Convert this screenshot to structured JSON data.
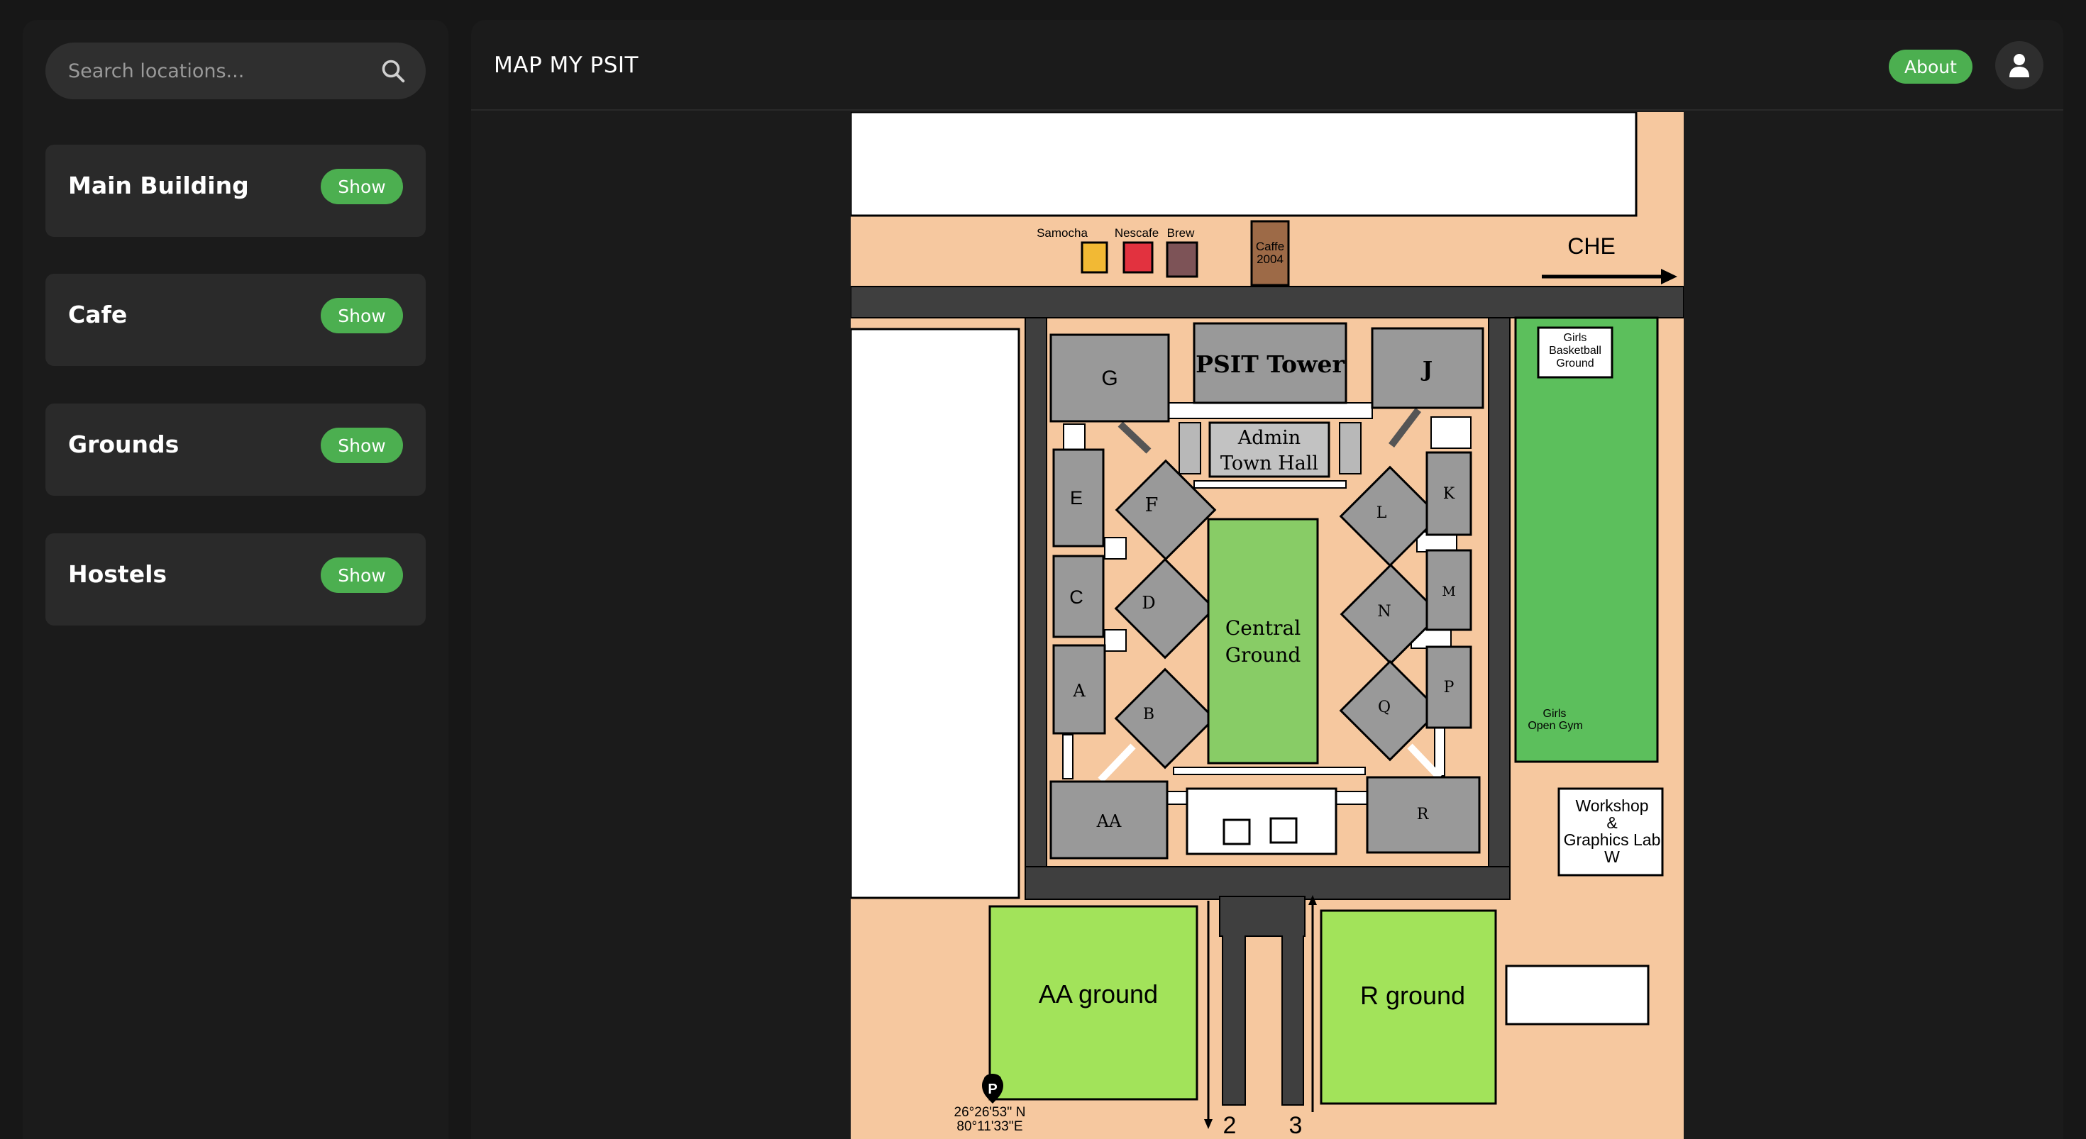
{
  "sidebar": {
    "search": {
      "placeholder": "Search locations..."
    },
    "categories": [
      {
        "label": "Main Building",
        "button": "Show"
      },
      {
        "label": "Cafe",
        "button": "Show"
      },
      {
        "label": "Grounds",
        "button": "Show"
      },
      {
        "label": "Hostels",
        "button": "Show"
      }
    ]
  },
  "header": {
    "title": "MAP MY PSIT",
    "about_label": "About"
  },
  "map": {
    "cafes": {
      "samocha": "Samocha",
      "nescafe": "Nescafe",
      "brew": "Brew",
      "caffe_line1": "Caffe",
      "caffe_line2": "2004"
    },
    "che": "CHE",
    "buildings": {
      "g": "G",
      "psit_tower": "PSIT Tower",
      "j": "J",
      "admin_line1": "Admin",
      "admin_line2": "Town Hall",
      "e": "E",
      "f": "F",
      "l": "L",
      "k": "K",
      "c": "C",
      "d": "D",
      "n": "N",
      "m": "M",
      "a": "A",
      "b": "B",
      "q": "Q",
      "p": "P",
      "aa": "AA",
      "r": "R",
      "central_line1": "Central",
      "central_line2": "Ground"
    },
    "girls_bb": [
      "Girls",
      "Basketball",
      "Ground"
    ],
    "girls_gym": [
      "Girls",
      "Open Gym"
    ],
    "workshop": [
      "Workshop",
      "&",
      "Graphics Lab",
      "W"
    ],
    "aa_ground": "AA ground",
    "r_ground": "R ground",
    "gate2": "2",
    "gate3": "3",
    "coords_line1": "26°26'53'' N",
    "coords_line2": "80°11'33''E"
  },
  "colors": {
    "accent": "#4caf50",
    "sand": "#f6c89f",
    "building": "#999999",
    "green": "#5cbf5c",
    "lime": "#a2e35a"
  }
}
